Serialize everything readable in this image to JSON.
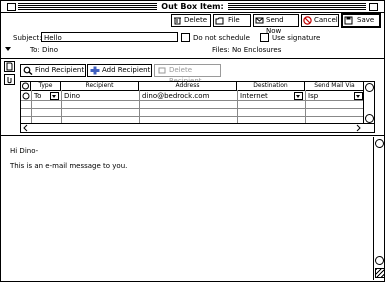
{
  "window": {
    "title": "Out Box Item:"
  },
  "toolbar": {
    "delete_label": "Delete",
    "file_label": "File",
    "send_now_label": "Send Now",
    "cancel_label": "Cancel",
    "save_label": "Save"
  },
  "header": {
    "subject_label": "Subject:",
    "subject_value": "Hello",
    "do_not_schedule_label": "Do not schedule",
    "use_signature_label": "Use signature",
    "to_label": "To: Dino",
    "files_label": "Files: No Enclosures"
  },
  "recipients": {
    "find_label": "Find Recipient",
    "add_label": "Add Recipient",
    "delete_label": "Delete Recipient",
    "columns": [
      "Type",
      "Recipient",
      "Address",
      "Destination",
      "Send Mail Via"
    ],
    "rows": [
      {
        "type": "To",
        "recipient": "Dino",
        "address": "dino@bedrock.com",
        "destination": "Internet",
        "via": "Isp"
      }
    ]
  },
  "message": {
    "lines": [
      "Hi Dino-",
      "This is an e-mail message to you."
    ]
  },
  "colors": {
    "accent_blue": "#4060c0",
    "cancel_red": "#c00000",
    "disabled_gray": "#9a9a9a"
  }
}
